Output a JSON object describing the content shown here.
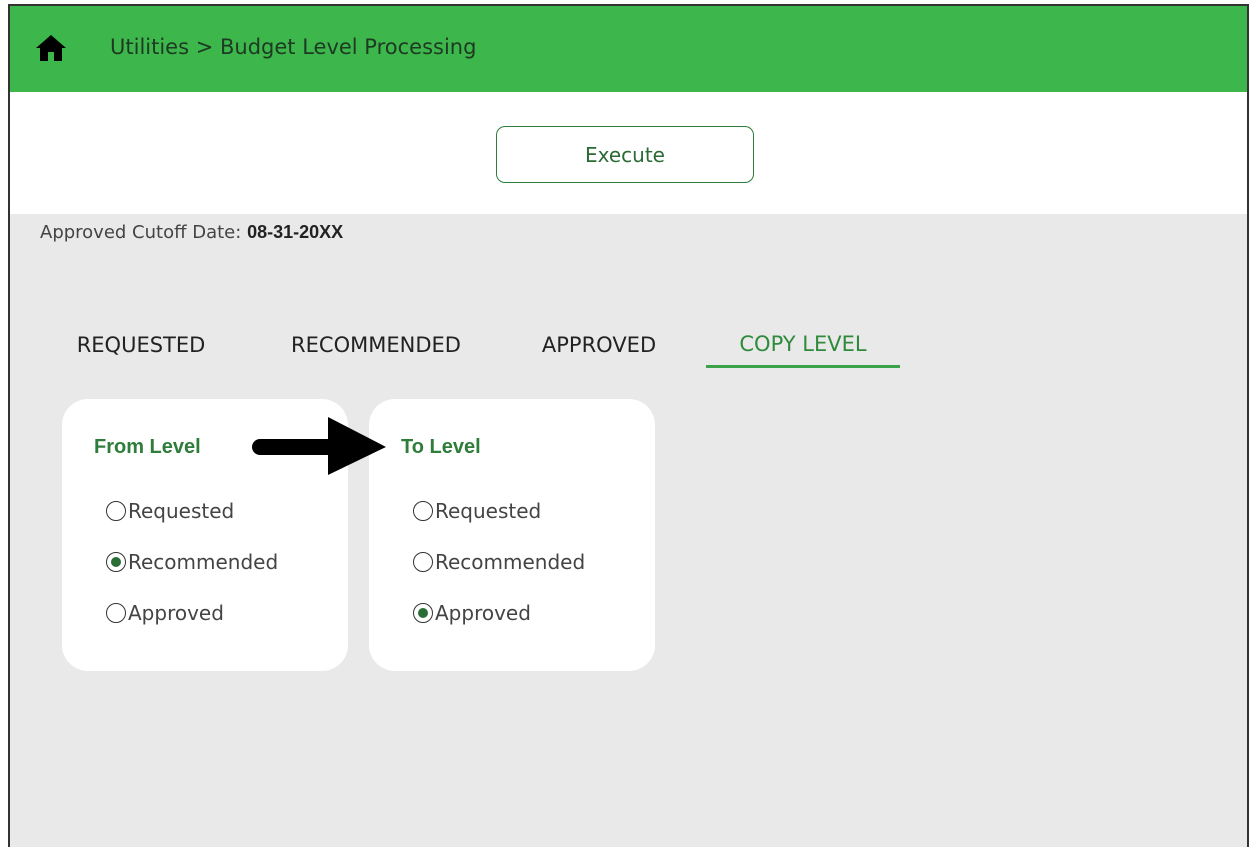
{
  "header": {
    "breadcrumb": "Utilities > Budget Level Processing",
    "home_icon": "home-icon",
    "background_color": "#3db64c"
  },
  "toolbar": {
    "execute_label": "Execute"
  },
  "cutoff": {
    "label": "Approved Cutoff Date:",
    "value": "08-31-20XX"
  },
  "tabs": [
    {
      "label": "REQUESTED",
      "active": false
    },
    {
      "label": "RECOMMENDED",
      "active": false
    },
    {
      "label": "APPROVED",
      "active": false
    },
    {
      "label": "COPY LEVEL",
      "active": true
    }
  ],
  "from_level": {
    "title": "From Level",
    "options": [
      {
        "label": "Requested",
        "checked": false
      },
      {
        "label": "Recommended",
        "checked": true
      },
      {
        "label": "Approved",
        "checked": false
      }
    ]
  },
  "to_level": {
    "title": "To Level",
    "options": [
      {
        "label": "Requested",
        "checked": false
      },
      {
        "label": "Recommended",
        "checked": false
      },
      {
        "label": "Approved",
        "checked": true
      }
    ]
  },
  "annotation": {
    "icon": "arrow-right-icon"
  },
  "colors": {
    "accent": "#2f8a3c",
    "header": "#3db64c",
    "panel_bg": "#e9e9e9"
  }
}
